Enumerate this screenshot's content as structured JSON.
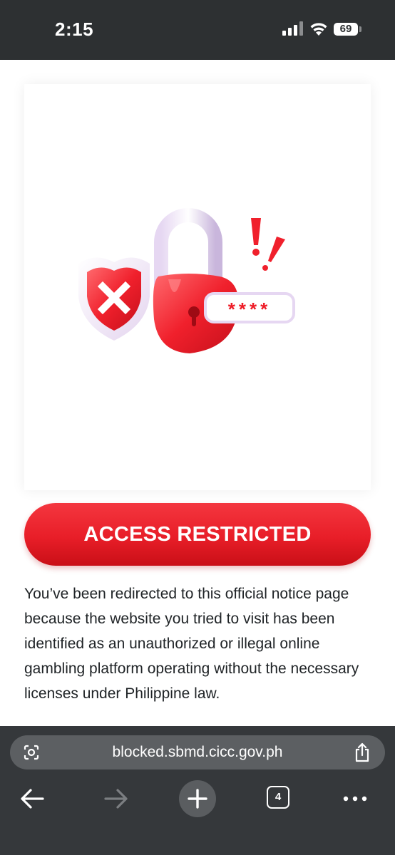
{
  "status_bar": {
    "time": "2:15",
    "battery_level": "69",
    "signal_icon": "cellular-signal-icon",
    "wifi_icon": "wifi-icon"
  },
  "hero": {
    "illustration_icon": "padlock-shield-password-illustration",
    "password_mask": "****",
    "exclamation_icon": "exclamation-marks-icon"
  },
  "banner": {
    "title": "ACCESS RESTRICTED",
    "color_top": "#f4363f",
    "color_bottom": "#c90f17"
  },
  "notice": {
    "body": "You’ve been redirected to this official notice page because the website you tried to visit has been identified as an unauthorized or illegal online gambling platform operating without the necessary licenses under Philippine law."
  },
  "browser": {
    "url": "blocked.sbmd.cicc.gov.ph",
    "tab_count": "4",
    "icons": {
      "lens": "google-lens-icon",
      "share": "share-icon",
      "back": "back-arrow-icon",
      "forward": "forward-arrow-icon",
      "new_tab": "plus-icon",
      "tabs": "tabs-icon",
      "more": "more-dots-icon"
    }
  }
}
